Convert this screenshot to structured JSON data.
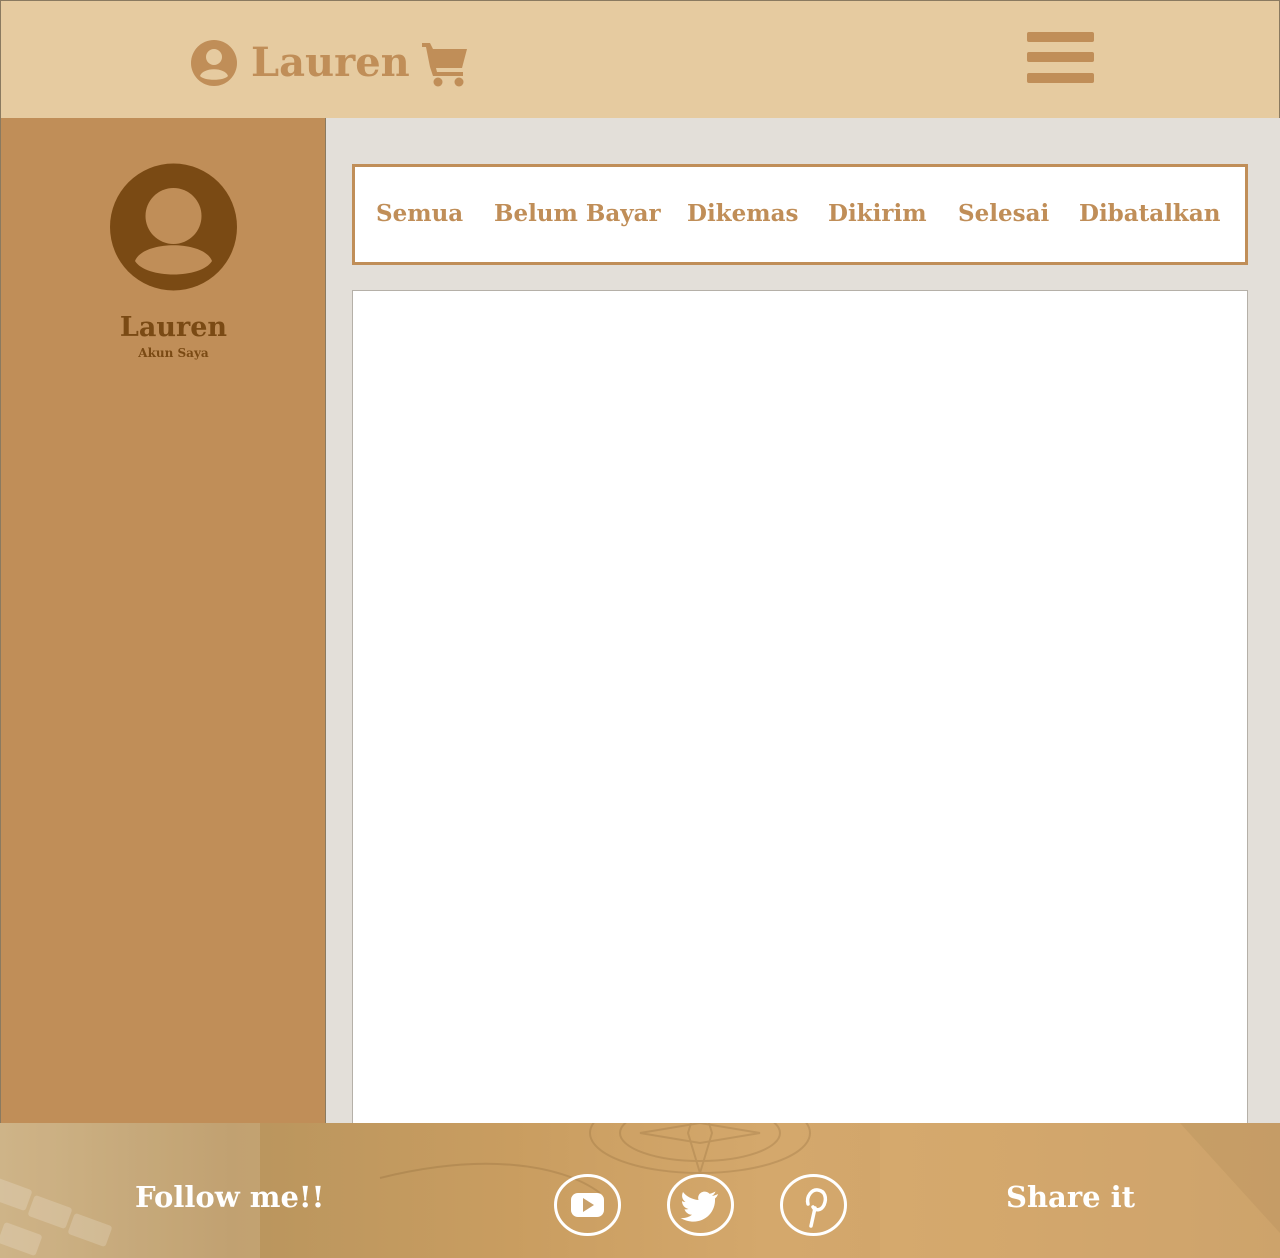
{
  "header": {
    "brand_name": "Lauren",
    "icons": {
      "user": "user-circle-icon",
      "cart": "shopping-cart-icon",
      "menu": "hamburger-menu-icon"
    }
  },
  "sidebar": {
    "profile_name": "Lauren",
    "profile_subtitle": "Akun Saya",
    "avatar_icon": "user-avatar-icon"
  },
  "main": {
    "tabs": [
      {
        "label": "Semua"
      },
      {
        "label": "Belum Bayar"
      },
      {
        "label": "Dikemas"
      },
      {
        "label": "Dikirim"
      },
      {
        "label": "Selesai"
      },
      {
        "label": "Dibatalkan"
      }
    ]
  },
  "footer": {
    "follow_label": "Follow me!!",
    "share_label": "Share it",
    "social_icons": [
      "youtube-icon",
      "twitter-icon",
      "pinterest-icon"
    ]
  },
  "colors": {
    "header_bg": "#e6cba0",
    "accent": "#c08e58",
    "profile_text": "#7a4a14",
    "main_bg": "#e3dfd9"
  }
}
